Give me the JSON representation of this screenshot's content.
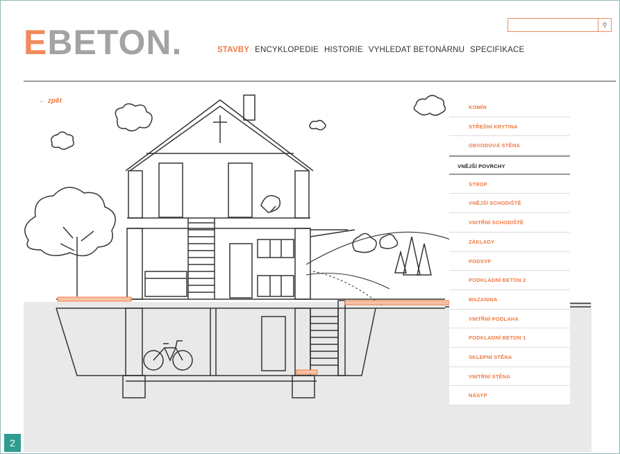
{
  "logo": {
    "first_letter": "E",
    "rest": "BETON."
  },
  "nav": {
    "items": [
      "STAVBY",
      "ENCYKLOPEDIE",
      "HISTORIE",
      "VYHLEDAT BETONÁRNU",
      "SPECIFIKACE"
    ]
  },
  "search": {
    "value": "",
    "button_icon": "search-icon"
  },
  "back": {
    "label": "←  zpět"
  },
  "menu": {
    "items": [
      "KOMÍN",
      "STŘEŠNÍ KRYTINA",
      "OBVODOVÁ STĚNA",
      "VNĚJŠÍ POVRCHY",
      "STROP",
      "VNĚJŠÍ SCHODIŠTĚ",
      "VNITŘNÍ SCHODIŠTĚ",
      "ZÁKLADY",
      "PODSYP",
      "PODKLADNÍ BETON 2",
      "MAZANINA",
      "VNITŘNÍ PODLAHA",
      "PODKLADNÍ BETON 1",
      "SKLEPNÍ STĚNA",
      "VNITŘNÍ STĚNA",
      "NÁSYP"
    ]
  },
  "badge": {
    "number": "2"
  },
  "colors": {
    "accent": "#f07a43",
    "frame": "#8fb9b4",
    "badge": "#2e9c8f"
  }
}
